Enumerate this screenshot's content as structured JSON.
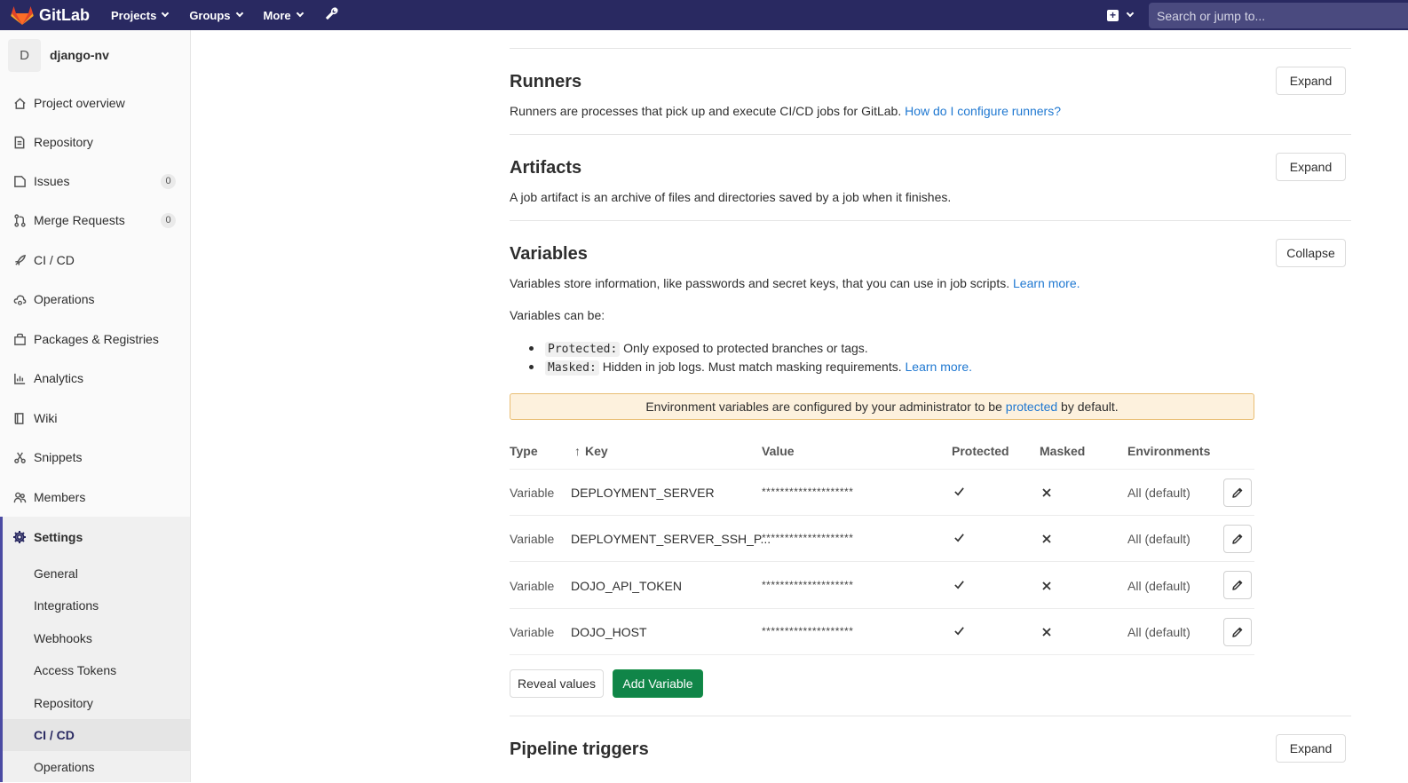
{
  "navbar": {
    "brand": "GitLab",
    "items": [
      {
        "label": "Projects"
      },
      {
        "label": "Groups"
      },
      {
        "label": "More"
      }
    ],
    "search_placeholder": "Search or jump to..."
  },
  "sidebar": {
    "project_initial": "D",
    "project_name": "django-nv",
    "items": [
      {
        "label": "Project overview",
        "icon": "home-icon"
      },
      {
        "label": "Repository",
        "icon": "doc-icon"
      },
      {
        "label": "Issues",
        "icon": "issues-icon",
        "badge": "0"
      },
      {
        "label": "Merge Requests",
        "icon": "merge-request-icon",
        "badge": "0"
      },
      {
        "label": "CI / CD",
        "icon": "rocket-icon"
      },
      {
        "label": "Operations",
        "icon": "cloud-gear-icon"
      },
      {
        "label": "Packages & Registries",
        "icon": "package-icon"
      },
      {
        "label": "Analytics",
        "icon": "chart-icon"
      },
      {
        "label": "Wiki",
        "icon": "book-icon"
      },
      {
        "label": "Snippets",
        "icon": "scissors-icon"
      },
      {
        "label": "Members",
        "icon": "users-icon"
      }
    ],
    "settings_label": "Settings",
    "settings_sub": [
      "General",
      "Integrations",
      "Webhooks",
      "Access Tokens",
      "Repository",
      "CI / CD",
      "Operations"
    ]
  },
  "runners": {
    "title": "Runners",
    "desc": "Runners are processes that pick up and execute CI/CD jobs for GitLab.",
    "link": "How do I configure runners?",
    "button": "Expand"
  },
  "artifacts": {
    "title": "Artifacts",
    "desc": "A job artifact is an archive of files and directories saved by a job when it finishes.",
    "button": "Expand"
  },
  "variables": {
    "title": "Variables",
    "button": "Collapse",
    "desc": "Variables store information, like passwords and secret keys, that you can use in job scripts.",
    "desc_link": "Learn more.",
    "can_be": "Variables can be:",
    "bullet_protected_code": "Protected:",
    "bullet_protected_text": "Only exposed to protected branches or tags.",
    "bullet_masked_code": "Masked:",
    "bullet_masked_text": "Hidden in job logs. Must match masking requirements.",
    "bullet_masked_link": "Learn more.",
    "alert_pre": "Environment variables are configured by your administrator to be",
    "alert_link": "protected",
    "alert_post": "by default.",
    "columns": {
      "type": "Type",
      "key": "Key",
      "value": "Value",
      "protected": "Protected",
      "masked": "Masked",
      "environments": "Environments"
    },
    "rows": [
      {
        "type": "Variable",
        "key": "DEPLOYMENT_SERVER",
        "value": "********************",
        "env": "All (default)"
      },
      {
        "type": "Variable",
        "key": "DEPLOYMENT_SERVER_SSH_P...",
        "value": "********************",
        "env": "All (default)"
      },
      {
        "type": "Variable",
        "key": "DOJO_API_TOKEN",
        "value": "********************",
        "env": "All (default)"
      },
      {
        "type": "Variable",
        "key": "DOJO_HOST",
        "value": "********************",
        "env": "All (default)"
      }
    ],
    "reveal_button": "Reveal values",
    "add_button": "Add Variable"
  },
  "pipeline_triggers": {
    "title": "Pipeline triggers",
    "button": "Expand"
  }
}
